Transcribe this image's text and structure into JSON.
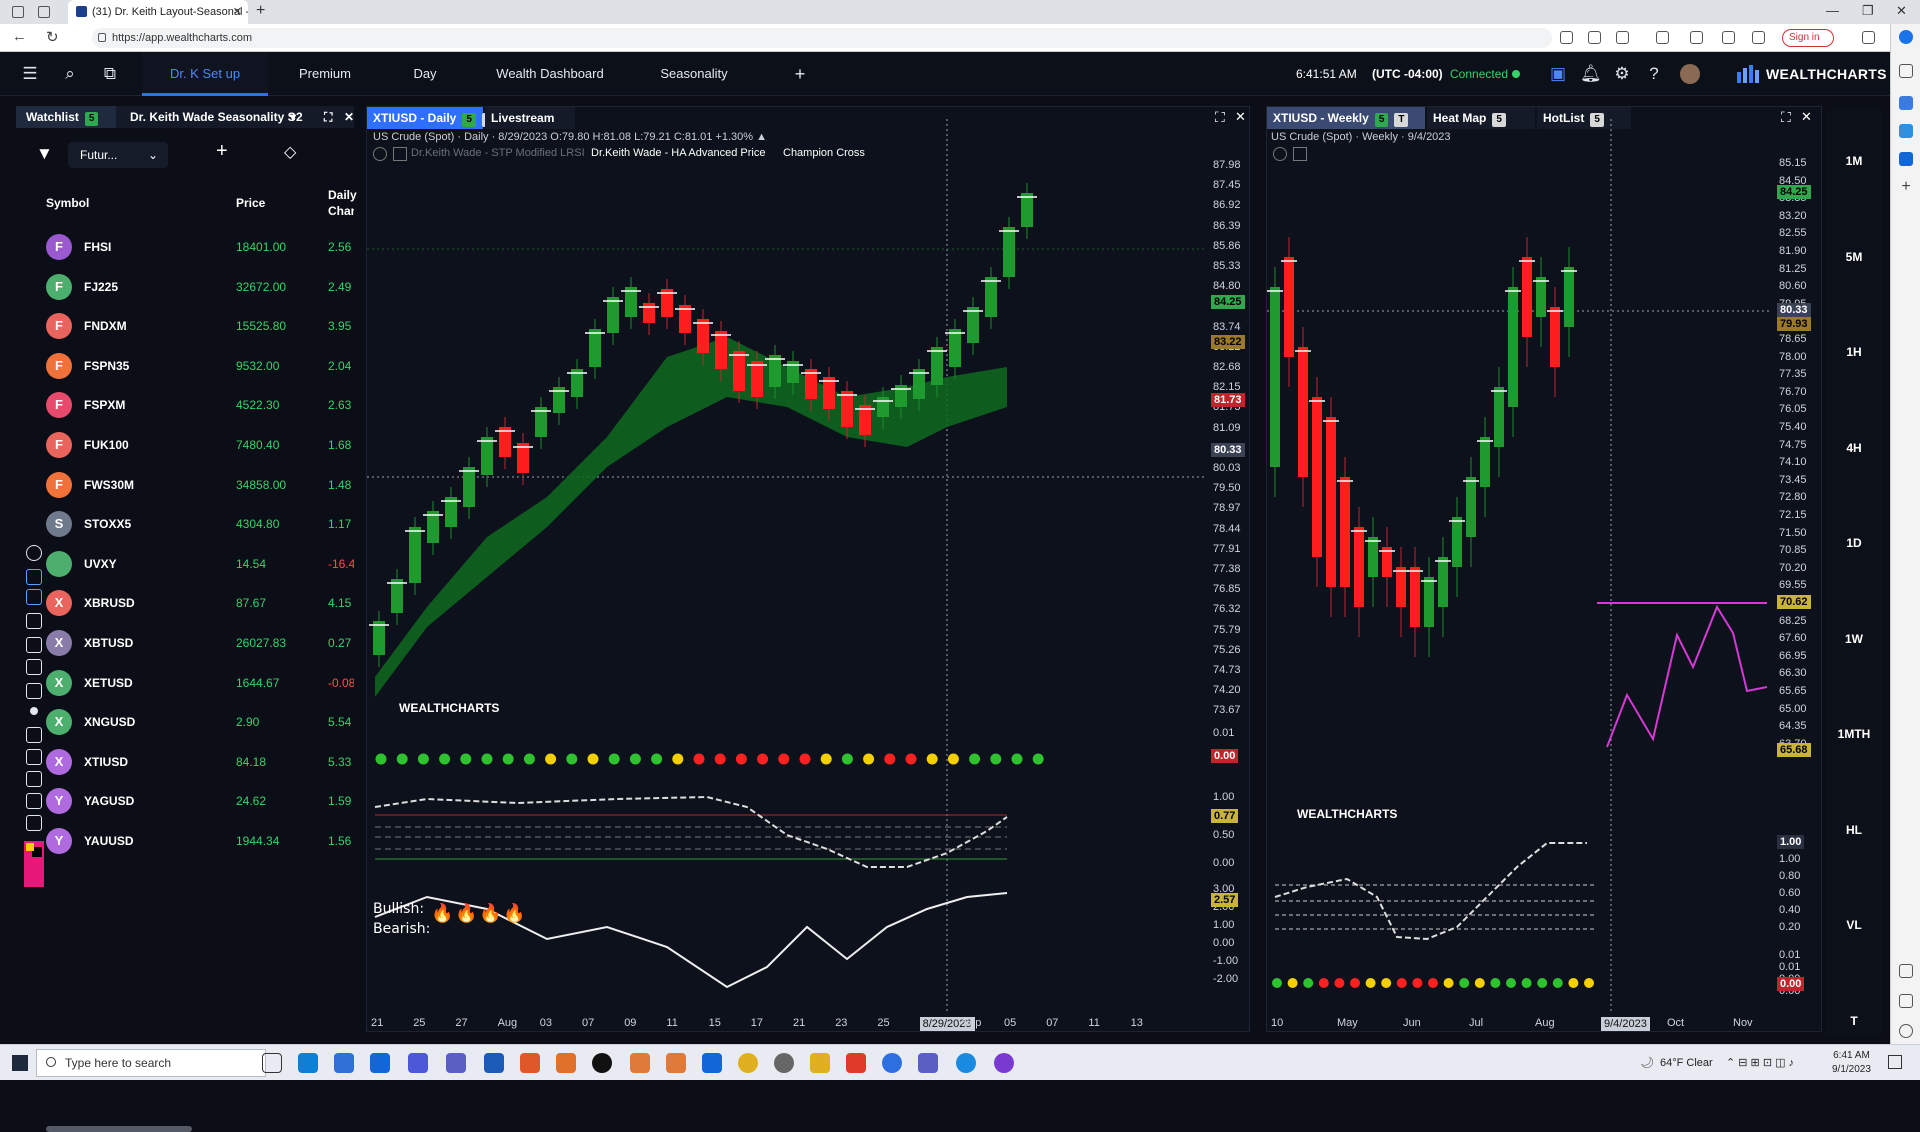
{
  "browser": {
    "tab_title": "(31) Dr. Keith Layout-Seasonal -",
    "url": "https://app.wealthcharts.com",
    "signin_label": "Sign in"
  },
  "header": {
    "tabs": [
      "Dr. K Set up",
      "Premium",
      "Day",
      "Wealth Dashboard",
      "Seasonality"
    ],
    "add_label": "+",
    "time": "6:41:51 AM",
    "timezone": "(UTC -04:00)",
    "connection": "Connected",
    "brand": "WEALTHCHARTS"
  },
  "watchlist": {
    "tab_label": "Watchlist",
    "tab_count": "5",
    "layout_tab_label": "Dr. Keith Wade Seasonality S",
    "layout_count": "2",
    "filter_value": "Futur...",
    "col_symbol": "Symbol",
    "col_price": "Price",
    "col_change_1": "Daily",
    "col_change_2": "Chan",
    "rows": [
      {
        "letter": "F",
        "symbol": "FHSI",
        "price": "18401.00",
        "change": "2.56",
        "color": "#9b59d0",
        "up": true
      },
      {
        "letter": "F",
        "symbol": "FJ225",
        "price": "32672.00",
        "change": "2.49",
        "color": "#4caf6e",
        "up": true
      },
      {
        "letter": "F",
        "symbol": "FNDXM",
        "price": "15525.80",
        "change": "3.95",
        "color": "#e8645c",
        "up": true
      },
      {
        "letter": "F",
        "symbol": "FSPN35",
        "price": "9532.00",
        "change": "2.04",
        "color": "#f0723a",
        "up": true
      },
      {
        "letter": "F",
        "symbol": "FSPXM",
        "price": "4522.30",
        "change": "2.63",
        "color": "#e84a6e",
        "up": true
      },
      {
        "letter": "F",
        "symbol": "FUK100",
        "price": "7480.40",
        "change": "1.68",
        "color": "#e8645c",
        "up": true
      },
      {
        "letter": "F",
        "symbol": "FWS30M",
        "price": "34858.00",
        "change": "1.48",
        "color": "#f0723a",
        "up": true
      },
      {
        "letter": "S",
        "symbol": "STOXX5",
        "price": "4304.80",
        "change": "1.17",
        "color": "#6f7a8c",
        "up": true
      },
      {
        "letter": "",
        "symbol": "UVXY",
        "price": "14.54",
        "change": "-16.4",
        "color": "#4caf6e",
        "up": false
      },
      {
        "letter": "X",
        "symbol": "XBRUSD",
        "price": "87.67",
        "change": "4.15",
        "color": "#e8645c",
        "up": true
      },
      {
        "letter": "X",
        "symbol": "XBTUSD",
        "price": "26027.83",
        "change": "0.27",
        "color": "#8a7ca8",
        "up": true
      },
      {
        "letter": "X",
        "symbol": "XETUSD",
        "price": "1644.67",
        "change": "-0.08",
        "color": "#4caf6e",
        "up": false
      },
      {
        "letter": "X",
        "symbol": "XNGUSD",
        "price": "2.90",
        "change": "5.54",
        "color": "#4caf6e",
        "up": true
      },
      {
        "letter": "X",
        "symbol": "XTIUSD",
        "price": "84.18",
        "change": "5.33",
        "color": "#b06ae0",
        "up": true
      },
      {
        "letter": "Y",
        "symbol": "YAGUSD",
        "price": "24.62",
        "change": "1.59",
        "color": "#b06ae0",
        "up": true
      },
      {
        "letter": "Y",
        "symbol": "YAUUSD",
        "price": "1944.34",
        "change": "1.56",
        "color": "#b06ae0",
        "up": true
      }
    ]
  },
  "daily_chart": {
    "tab_label": "XTIUSD - Daily",
    "tab_count": "5",
    "tab_t": "T",
    "tab2_label": "Livestream",
    "info_line": "US Crude (Spot) · Daily · 8/29/2023 O:79.80 H:81.08 L:79.21 C:81.01 +1.30% ▲",
    "indicators": "Dr.Keith Wade - STP Modified LRSI",
    "indicator2": "Dr.Keith Wade - HA Advanced Price",
    "indicator3": "Champion Cross",
    "price_axis": [
      "87.98",
      "87.45",
      "86.92",
      "86.39",
      "85.86",
      "85.33",
      "84.80",
      "84.25",
      "83.74",
      "83.22",
      "82.68",
      "82.15",
      "81.73",
      "81.09",
      "80.56",
      "80.03",
      "79.50",
      "78.97",
      "78.44",
      "77.91",
      "77.38",
      "76.85",
      "76.32",
      "75.79",
      "75.26",
      "74.73",
      "74.20",
      "73.67"
    ],
    "tag_last": "84.25",
    "tag_mid": "83.22",
    "tag_red": "81.73",
    "tag_cross": "80.33",
    "osc_top": "0.01",
    "osc_val": "0.00",
    "lrsi_axis": [
      "1.00",
      "0.50",
      "0.00"
    ],
    "lrsi_val": "0.77",
    "sub_axis": [
      "3.00",
      "2.00",
      "1.00",
      "0.00",
      "-1.00",
      "-2.00"
    ],
    "sub_val": "2.57",
    "bullish": "Bullish:",
    "bearish": "Bearish:",
    "wc_label": "WEALTHCHARTS",
    "x_labels": [
      "21",
      "25",
      "27",
      "Aug",
      "03",
      "07",
      "09",
      "11",
      "15",
      "17",
      "21",
      "23",
      "25",
      "8/29/2023",
      "Sep",
      "05",
      "07",
      "11",
      "13"
    ]
  },
  "weekly_chart": {
    "tab_label": "XTIUSD - Weekly",
    "tab_count": "5",
    "tab_t": "T",
    "tab2_label": "Heat Map",
    "tab2_count": "5",
    "tab3_label": "HotList",
    "tab3_count": "5",
    "info_line": "US Crude (Spot) · Weekly · 9/4/2023",
    "price_axis": [
      "85.15",
      "84.50",
      "83.85",
      "83.20",
      "82.55",
      "81.90",
      "81.25",
      "80.60",
      "79.95",
      "79.30",
      "78.65",
      "78.00",
      "77.35",
      "76.70",
      "76.05",
      "75.40",
      "74.75",
      "74.10",
      "73.45",
      "72.80",
      "72.15",
      "71.50",
      "70.85",
      "70.20",
      "69.55",
      "68.90",
      "68.25",
      "67.60",
      "66.95",
      "66.30",
      "65.65",
      "65.00",
      "64.35",
      "63.70"
    ],
    "tag_last": "84.25",
    "tag_cross": "80.33",
    "tag_mid": "79.93",
    "tag_70": "70.62",
    "tag_65": "65.68",
    "lrsi_axis": [
      "1.00",
      "0.80",
      "0.60",
      "0.40",
      "0.20"
    ],
    "lrsi_val": "1.00",
    "osc_axis": [
      "0.01",
      "0.01",
      "0.00",
      "0.00"
    ],
    "osc_val": "0.00",
    "wc_label": "WEALTHCHARTS",
    "x_labels": [
      "10",
      "May",
      "Jun",
      "Jul",
      "Aug",
      "9/4/2023",
      "Oct",
      "Nov"
    ]
  },
  "timeframes": [
    "1M",
    "5M",
    "1H",
    "4H",
    "1D",
    "1W",
    "1MTH",
    "HL",
    "VL",
    "T"
  ],
  "taskbar": {
    "search_placeholder": "Type here to search",
    "weather": "64°F Clear",
    "time": "6:41 AM",
    "date": "9/1/2023"
  }
}
